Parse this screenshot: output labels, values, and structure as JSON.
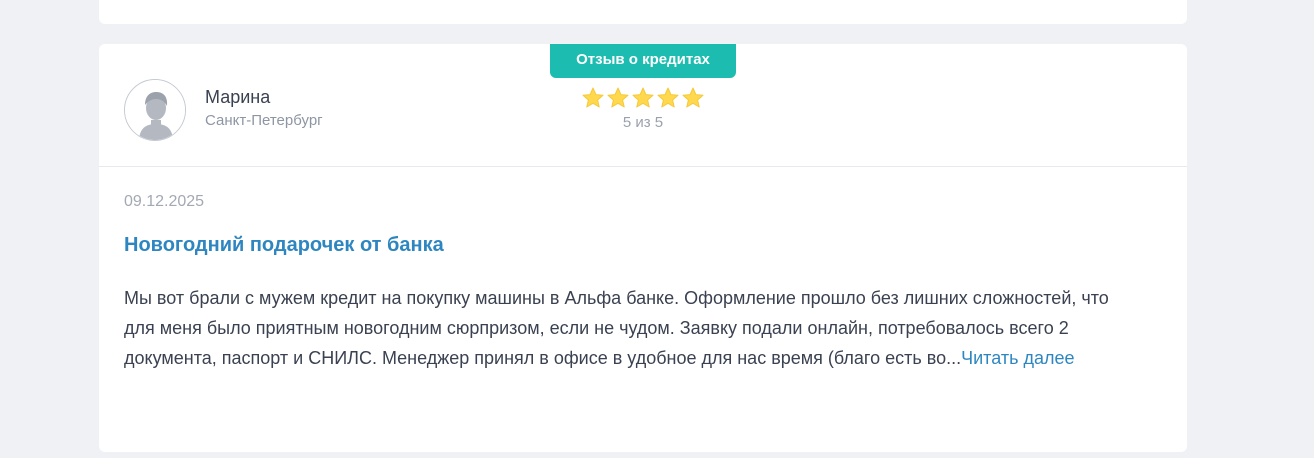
{
  "review": {
    "badge": "Отзыв о кредитах",
    "author": {
      "name": "Марина",
      "city": "Санкт-Петербург"
    },
    "rating": {
      "value": 5,
      "max": 5,
      "text": "5 из 5"
    },
    "date": "09.12.2025",
    "title": "Новогодний подарочек от банка",
    "body": "Мы вот брали с мужем кредит на покупку машины в Альфа банке. Оформление прошло без лишних сложностей, что для меня было приятным новогодним сюрпризом, если не чудом. Заявку подали онлайн, потребовалось всего 2 документа, паспорт и СНИЛС. Менеджер принял в офисе в удобное для нас время (благо есть во...",
    "read_more": "Читать далее"
  },
  "colors": {
    "accent": "#1cbdb0",
    "link": "#2e86c1",
    "star": "#ffd84d",
    "background": "#eff1f4"
  },
  "icons": {
    "avatar": "user-avatar-icon",
    "star": "star-icon"
  }
}
